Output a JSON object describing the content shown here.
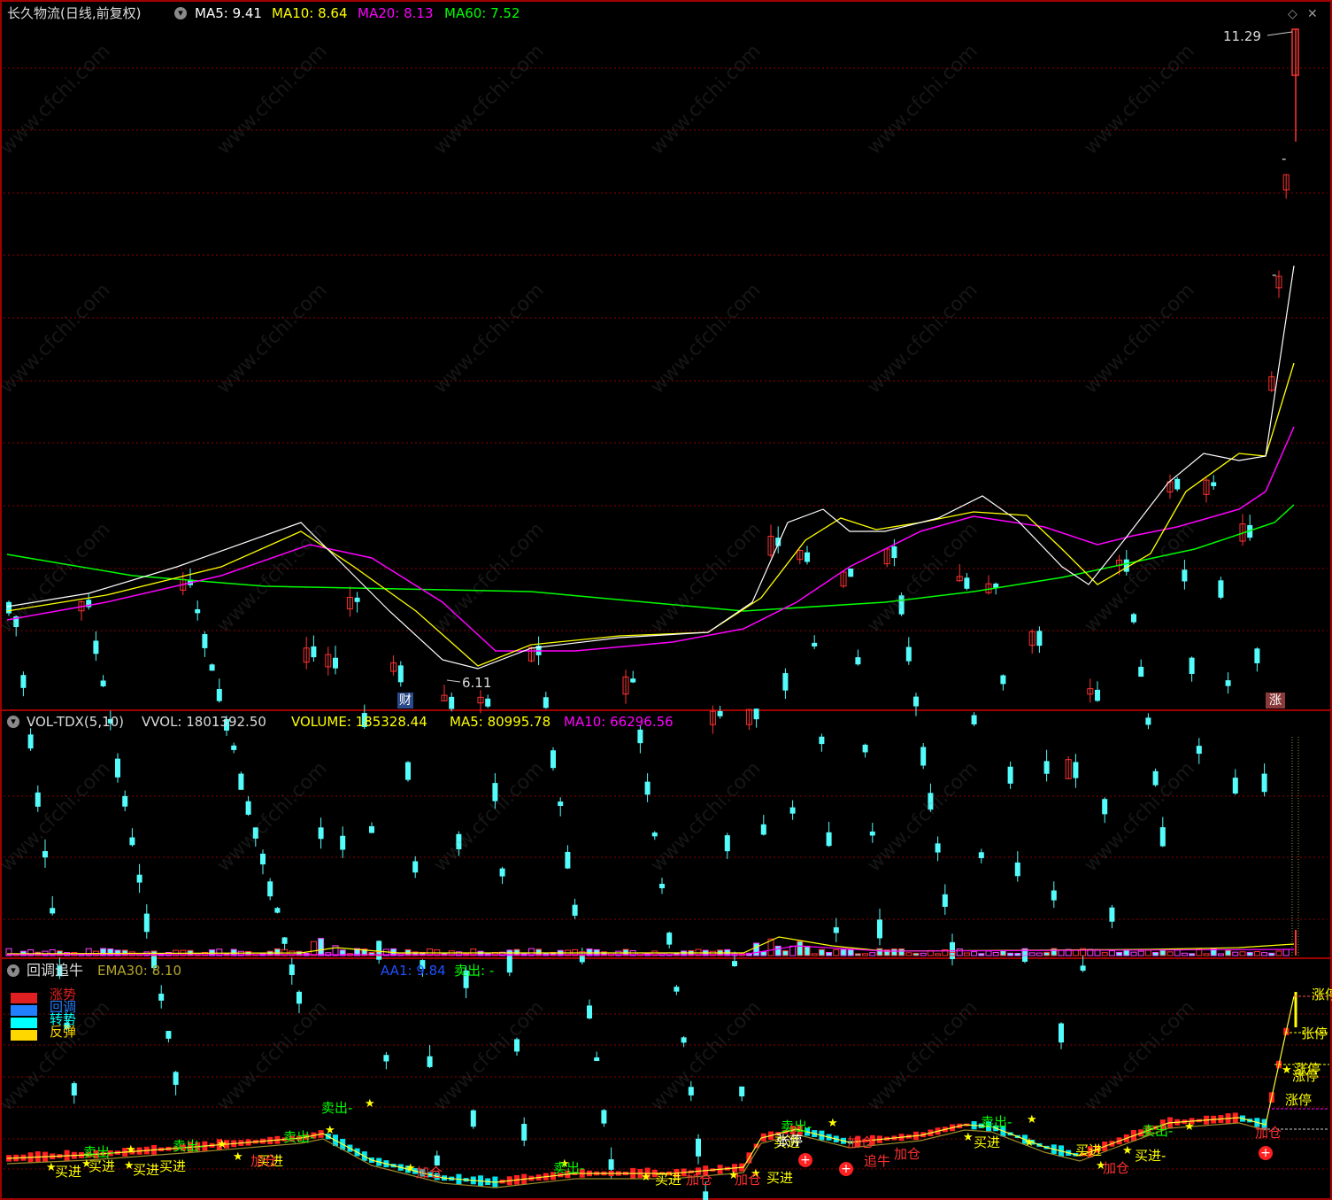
{
  "main": {
    "stock_title": "长久物流(日线,前复权)",
    "ma5": "MA5: 9.41",
    "ma10": "MA10: 8.64",
    "ma20": "MA20: 8.13",
    "ma60": "MA60: 7.52",
    "high_label": "11.29",
    "low_label": "6.11",
    "cai_badge": "财",
    "zhang_badge": "涨",
    "dash1": "-",
    "dash2": "-"
  },
  "volume": {
    "indicator": "VOL-TDX(5,10)",
    "vvol": "VVOL: 1801392.50",
    "volume": "VOLUME: 185328.44",
    "ma5": "MA5: 80995.78",
    "ma10": "MA10: 66296.56"
  },
  "bottom": {
    "indicator": "回调追牛",
    "ema30": "EMA30: 8.10",
    "aa1": "AA1: 9.84",
    "sell": "卖出: -",
    "legend": [
      "涨势",
      "回调",
      "转势",
      "反弹"
    ]
  },
  "signals": {
    "sell_1": "卖出-",
    "sell_2": "卖出-",
    "sell_3": "卖出-",
    "sell_4": "卖出-",
    "sell_5": "卖出-",
    "sell_6": "卖出-",
    "sell_7": "卖出-",
    "sell_8": "卖出-",
    "buy_1": "买进",
    "buy_2": "买进",
    "buy_3": "买进",
    "buy_4": "买进",
    "buy_5": "买进",
    "buy_6": "买进",
    "buy_7": "买进",
    "buy_8": "买进",
    "buy_9": "买进",
    "buy_10": "买进",
    "buy_11": "买进-",
    "add_1": "加仓",
    "add_2": "加仓",
    "add_3": "加仓",
    "add_4": "加仓",
    "add_5": "加仓",
    "add_6": "加仓",
    "add_7": "加仓",
    "add_8": "加仓",
    "chase": "追牛",
    "limit_1": "涨停",
    "limit_2": "张停",
    "limit_3": "涨停",
    "limit_4": "涨停",
    "limit_5": "涨停",
    "limit_6": "张停"
  },
  "watermark": "www.cfchi.com",
  "colors": {
    "up": "#ff3232",
    "down": "#54fcfc",
    "ma5": "#ffffff",
    "ma10": "#ffff00",
    "ma20": "#ff00ff",
    "ma60": "#00ff00",
    "grid": "#8b0000",
    "frame": "#a00000"
  }
}
